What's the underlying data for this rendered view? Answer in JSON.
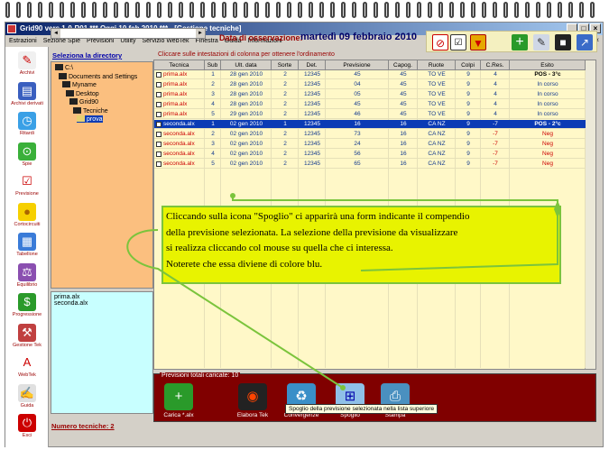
{
  "window": {
    "title": "Grid90 vers.1-0-R01  ***  Oggi 10 feb 2010  ***  - [Gestione tecniche]"
  },
  "menu": [
    "Estrazioni",
    "Sezione Spie",
    "Previsioni",
    "Utility",
    "Servizio WebTek",
    "Finestra",
    "Guida",
    "Informazioni"
  ],
  "sidebar": {
    "items": [
      {
        "label": "Archivi",
        "icon": "pencil-icon"
      },
      {
        "label": "Archivi derivati",
        "icon": "derived-archive-icon"
      },
      {
        "label": "Ritardi",
        "icon": "clock-icon"
      },
      {
        "label": "Spie",
        "icon": "binoculars-icon"
      },
      {
        "label": "Previsione",
        "icon": "checklist-icon"
      },
      {
        "label": "Cortocircuiti",
        "icon": "lightbulb-icon"
      },
      {
        "label": "Tabellone",
        "icon": "calendar-icon"
      },
      {
        "label": "Equilibrio",
        "icon": "scale-icon"
      },
      {
        "label": "Progressione",
        "icon": "dollar-icon"
      },
      {
        "label": "Gestione Tek",
        "icon": "tools-icon"
      },
      {
        "label": "WebTek",
        "icon": "webtek-icon"
      },
      {
        "label": "Guida",
        "icon": "guide-icon"
      },
      {
        "label": "Esci",
        "icon": "exit-icon"
      }
    ]
  },
  "observation": {
    "label": "Data di osservazione:",
    "date": "martedì 09 febbraio 2010"
  },
  "directory": {
    "title": "Seleziona la directory",
    "items": [
      {
        "label": "C:\\",
        "indent": 0
      },
      {
        "label": "Documents and Settings",
        "indent": 1
      },
      {
        "label": "Myname",
        "indent": 2
      },
      {
        "label": "Desktop",
        "indent": 3
      },
      {
        "label": "Grid90",
        "indent": 4
      },
      {
        "label": "Tecniche",
        "indent": 5
      },
      {
        "label": "prova",
        "indent": 6,
        "selected": true
      }
    ]
  },
  "files": [
    "prima.alx",
    "seconda.alx"
  ],
  "num_tecniche": "Numero tecniche: 2",
  "sort_hint": "Cliccare sulle intestazioni di colonna per ottenere l'ordinamento",
  "grid": {
    "headers": [
      "Tecnica",
      "Sub",
      "Ult. data",
      "Sorte",
      "Det.",
      "Previsione",
      "Capog.",
      "Ruote",
      "Colpi",
      "C.Res.",
      "Esito"
    ],
    "rows": [
      [
        "prima.alx",
        "1",
        "28 gen 2010",
        "2",
        "12345",
        "45",
        "45",
        "TO VE",
        "9",
        "4",
        "POS - 3°c"
      ],
      [
        "prima.alx",
        "2",
        "28 gen 2010",
        "2",
        "12345",
        "04",
        "45",
        "TO VE",
        "9",
        "4",
        "In corso"
      ],
      [
        "prima.alx",
        "3",
        "28 gen 2010",
        "2",
        "12345",
        "05",
        "45",
        "TO VE",
        "9",
        "4",
        "In corso"
      ],
      [
        "prima.alx",
        "4",
        "28 gen 2010",
        "2",
        "12345",
        "45",
        "45",
        "TO VE",
        "9",
        "4",
        "In corso"
      ],
      [
        "prima.alx",
        "5",
        "29 gen 2010",
        "2",
        "12345",
        "46",
        "45",
        "TO VE",
        "9",
        "4",
        "In corso"
      ],
      [
        "seconda.alx",
        "1",
        "02 gen 2010",
        "1",
        "12345",
        "16",
        "16",
        "CA NZ",
        "9",
        "-7",
        "POS - 2°c"
      ],
      [
        "seconda.alx",
        "2",
        "02 gen 2010",
        "2",
        "12345",
        "73",
        "16",
        "CA NZ",
        "9",
        "-7",
        "Neg"
      ],
      [
        "seconda.alx",
        "3",
        "02 gen 2010",
        "2",
        "12345",
        "24",
        "16",
        "CA NZ",
        "9",
        "-7",
        "Neg"
      ],
      [
        "seconda.alx",
        "4",
        "02 gen 2010",
        "2",
        "12345",
        "56",
        "16",
        "CA NZ",
        "9",
        "-7",
        "Neg"
      ],
      [
        "seconda.alx",
        "5",
        "02 gen 2010",
        "2",
        "12345",
        "65",
        "16",
        "CA NZ",
        "9",
        "-7",
        "Neg"
      ]
    ],
    "selected_row": 5
  },
  "bottom": {
    "legend": "Previsioni totali caricate: 10",
    "buttons": [
      {
        "label": "Carica *.alx",
        "icon": "load-file-icon"
      },
      {
        "label": "Elabora Tek",
        "icon": "process-icon"
      },
      {
        "label": "Convergenze",
        "icon": "recycle-icon"
      },
      {
        "label": "Spoglio",
        "icon": "windows-icon"
      },
      {
        "label": "Stampa",
        "icon": "printer-icon"
      }
    ],
    "tooltip": "Spoglio della previsione selezionata nella lista superiore"
  },
  "callout": {
    "lines": [
      "Cliccando sulla icona \"Spoglio\" ci apparirà una form indicante il compendio",
      "della previsione selezionata. La selezione della previsione da visualizzare",
      "si realizza cliccando col mouse su quella che ci interessa.",
      "Noterete che essa diviene di colore blu."
    ]
  },
  "colors": {
    "callout_bg": "#e8f300",
    "selection": "#0b3bb5",
    "bottom_panel": "#800000",
    "dir_panel": "#fbbf7f"
  }
}
